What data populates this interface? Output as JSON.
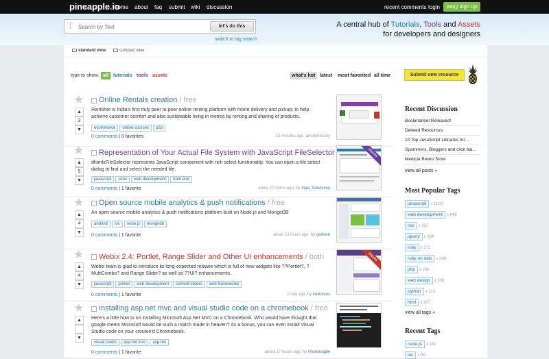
{
  "topbar": {
    "logo_main": "pineapple",
    "logo_dot": ".",
    "logo_tld": "io",
    "nav": [
      "home",
      "about",
      "faq",
      "submit",
      "wiki",
      "discussion"
    ],
    "recent_comments": "recent comments",
    "login": "login",
    "signup": "easy sign up"
  },
  "search": {
    "placeholder": "Search by Text",
    "t_glyph": "T",
    "button": "let's do this",
    "switch": "switch to tag search"
  },
  "tagline": {
    "prefix": "A central hub of",
    "tutorials": "Tutorials",
    "comma": ",",
    "tools": "Tools",
    "and": "and",
    "assets": "Assets",
    "line2": "for developers and designers"
  },
  "views": {
    "standard": "standard view",
    "compact": "compact view"
  },
  "filters": {
    "label": "type to show:",
    "all": "all",
    "tutorials": "tutorials",
    "tools": "tools",
    "assets": "assets",
    "sorts": [
      "what's hot",
      "latest",
      "most favorited",
      "all time"
    ],
    "submit": "Submit new resource"
  },
  "posts": [
    {
      "title": "Online Rentals creation",
      "kind": "/ free",
      "title_color": "#2a7ab0",
      "votes": "3",
      "desc": "Rentsher is India's first truly peer to peer online renting platform with home delivery and pickup; to help achieve customer comfort and also sustainable living in metros by renting and sharing of products.",
      "tags": [
        "ecommerce",
        "online courses",
        "p2p"
      ],
      "comments": "0 comments",
      "favorites": "0 favorites",
      "when": "13 minutes ago, anonymously",
      "user": ""
    },
    {
      "title": "Representation of Your Actual File System with JavaScript FileSelector",
      "kind": "/ free",
      "title_color": "#6a3ea1",
      "votes": "5",
      "desc": "dhtmlxFileSelector represents JavaScript component with rich select functionality. You can open a file select dialog to find and select the needed file.",
      "tags": [
        "javascript",
        "ui/ux",
        "web development",
        "front end"
      ],
      "comments": "0 comments",
      "favorites": "1 favorite",
      "when": "about 20 hours ago, by",
      "user": "Inga_Kravtsova",
      "ribbon": "popular"
    },
    {
      "title": "Open source mobile analytics & push notifications",
      "kind": "/ free",
      "title_color": "#2a7ab0",
      "votes": "4",
      "desc": "An open source mobile analytics & push notifications platform built on Node.js and MongoDB",
      "tags": [
        "android",
        "ios",
        "node.js",
        "mongodb"
      ],
      "comments": "0 comments",
      "favorites": "1 favorite",
      "when": "about 13 hours ago, by",
      "user": "gorkem"
    },
    {
      "title": "Webix 2.4: Portlet, Range Slider and Other UI enhancements",
      "kind": "/ both",
      "title_color": "#c0392b",
      "votes": "4",
      "desc": "Webix team is glad to introduce its long-expected release which is full of new widgets like ??Portlet?, ?MultiCombo? and Range Slider? as well as ??UI? enhancements.",
      "tags": [
        "javascript",
        "portlet",
        "web development",
        "content sliders",
        "web frameworks"
      ],
      "comments": "0 comments",
      "favorites": "1 favorite",
      "when": "1 day ago, by",
      "user": "keliuvuus",
      "ribbon": "popular"
    },
    {
      "title": "Installing asp.net mvc and visual studio code on a chromebook",
      "kind": "/ free",
      "title_color": "#2a7ab0",
      "votes": "",
      "desc": "Here's a little how to on installing Microsoft Asp.Net MVC on a Chromebook. Who would have thought that google meets Microsoft would be such a match made in heaven? As a bonus, you can even install Visual Studio code on your crouton'd Chromebook.",
      "tags": [
        "visual studio",
        "asp.net mvc",
        "asp.net"
      ],
      "comments": "0 comments",
      "favorites": "1 favorite",
      "when": "about 17 hours ago, by",
      "user": "intenseagile"
    }
  ],
  "sidebar": {
    "recent_discussion_title": "Recent Discussion",
    "discussions": [
      "Bookmarklet Released!",
      "Deleted Resources",
      "10 Top JavaScript Libraries for ...",
      "Spammers, Bloggers and click bai...",
      "Medical Books Store"
    ],
    "view_all_posts": "view all posts »",
    "popular_tags_title": "Most Popular Tags",
    "popular_tags": [
      {
        "name": "javascript",
        "count": "x 1109"
      },
      {
        "name": "web development",
        "count": "x 649"
      },
      {
        "name": "css",
        "count": "x 337"
      },
      {
        "name": "jquery",
        "count": "x 324"
      },
      {
        "name": "ruby",
        "count": "x 272"
      },
      {
        "name": "ruby on rails",
        "count": "x 248"
      },
      {
        "name": "php",
        "count": "x 241"
      },
      {
        "name": "web design",
        "count": "x 238"
      },
      {
        "name": "python",
        "count": "x 213"
      },
      {
        "name": "html",
        "count": "x 207"
      }
    ],
    "view_all_tags": "view all tags »",
    "recent_tags_title": "Recent Tags",
    "recent_tags": [
      {
        "name": "node.js",
        "count": "x 181"
      },
      {
        "name": "ios",
        "count": "x 90"
      }
    ]
  },
  "colors": {
    "brand_green": "#7bc043",
    "link_blue": "#2a7ab0",
    "submit_yellow": "#f5e33b"
  }
}
